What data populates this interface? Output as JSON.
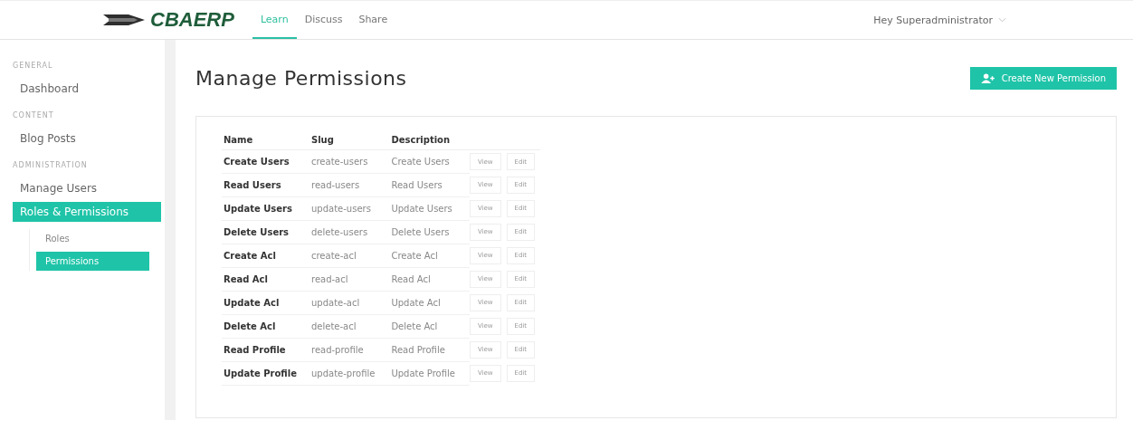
{
  "brand": "CBAERP",
  "nav_tabs": [
    {
      "label": "Learn",
      "selected": true
    },
    {
      "label": "Discuss",
      "selected": false
    },
    {
      "label": "Share",
      "selected": false
    }
  ],
  "user_menu": "Hey Superadministrator",
  "sidebar": [
    {
      "heading": "GENERAL",
      "items": [
        {
          "label": "Dashboard",
          "selected": false
        }
      ]
    },
    {
      "heading": "CONTENT",
      "items": [
        {
          "label": "Blog Posts",
          "selected": false
        }
      ]
    },
    {
      "heading": "ADMINISTRATION",
      "items": [
        {
          "label": "Manage Users",
          "selected": false
        },
        {
          "label": "Roles & Permissions",
          "selected": true,
          "children": [
            {
              "label": "Roles",
              "selected": false
            },
            {
              "label": "Permissions",
              "selected": true
            }
          ]
        }
      ]
    }
  ],
  "page_title": "Manage Permissions",
  "create_button": "Create New Permission",
  "table": {
    "columns": [
      "Name",
      "Slug",
      "Description"
    ],
    "rows": [
      {
        "name": "Create Users",
        "slug": "create-users",
        "description": "Create Users",
        "actions": [
          "View",
          "Edit"
        ]
      },
      {
        "name": "Read Users",
        "slug": "read-users",
        "description": "Read Users",
        "actions": [
          "View",
          "Edit"
        ]
      },
      {
        "name": "Update Users",
        "slug": "update-users",
        "description": "Update Users",
        "actions": [
          "View",
          "Edit"
        ]
      },
      {
        "name": "Delete Users",
        "slug": "delete-users",
        "description": "Delete Users",
        "actions": [
          "View",
          "Edit"
        ]
      },
      {
        "name": "Create Acl",
        "slug": "create-acl",
        "description": "Create Acl",
        "actions": [
          "View",
          "Edit"
        ]
      },
      {
        "name": "Read Acl",
        "slug": "read-acl",
        "description": "Read Acl",
        "actions": [
          "View",
          "Edit"
        ]
      },
      {
        "name": "Update Acl",
        "slug": "update-acl",
        "description": "Update Acl",
        "actions": [
          "View",
          "Edit"
        ]
      },
      {
        "name": "Delete Acl",
        "slug": "delete-acl",
        "description": "Delete Acl",
        "actions": [
          "View",
          "Edit"
        ]
      },
      {
        "name": "Read Profile",
        "slug": "read-profile",
        "description": "Read Profile",
        "actions": [
          "View",
          "Edit"
        ]
      },
      {
        "name": "Update Profile",
        "slug": "update-profile",
        "description": "Update Profile",
        "actions": [
          "View",
          "Edit"
        ]
      }
    ]
  }
}
